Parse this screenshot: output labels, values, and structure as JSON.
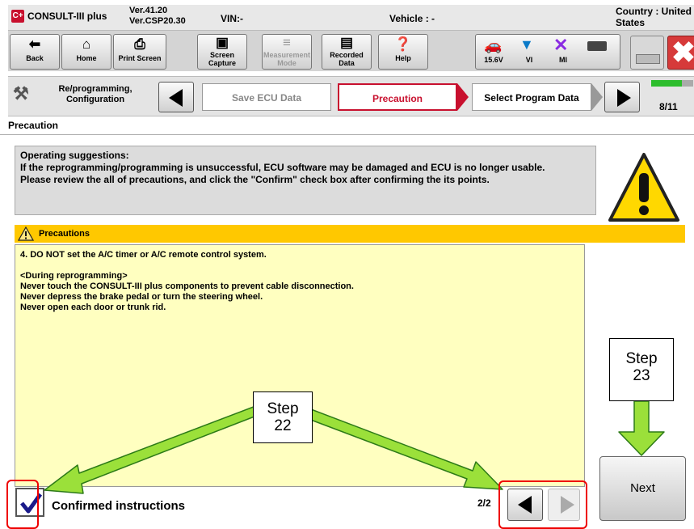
{
  "titlebar": {
    "app_logo": "C+",
    "app_name": "CONSULT-III plus",
    "version_line1": "Ver.41.20",
    "version_line2": "Ver.CSP20.30",
    "vin_label": "VIN:-",
    "vehicle_label": "Vehicle : -",
    "country_line1": "Country : United",
    "country_line2": "States"
  },
  "toolbar": {
    "buttons": [
      {
        "label": "Back",
        "icon": "back-arrow-icon"
      },
      {
        "label": "Home",
        "icon": "home-icon"
      },
      {
        "label": "Print Screen",
        "icon": "printer-icon"
      },
      {
        "label_line1": "Screen",
        "label_line2": "Capture",
        "icon": "camera-icon"
      },
      {
        "label_line1": "Measurement",
        "label_line2": "Mode",
        "icon": "measurement-icon"
      },
      {
        "label_line1": "Recorded",
        "label_line2": "Data",
        "icon": "recorded-data-icon"
      },
      {
        "label": "Help",
        "icon": "help-icon"
      }
    ],
    "status": {
      "voltage": "15.6V",
      "vi": "VI",
      "mi": "MI"
    }
  },
  "stepbar": {
    "section_line1": "Re/programming,",
    "section_line2": "Configuration",
    "prev_step": "Save ECU Data",
    "current_step": "Precaution",
    "next_step": "Select Program Data",
    "progress_label": "8/11",
    "progress_fraction": 0.727
  },
  "page_title": "Precaution",
  "suggestions": {
    "heading": "Operating  suggestions:",
    "line1": "If the reprogramming/programming is unsuccessful, ECU software may be damaged and ECU is no longer usable.",
    "line2": "Please review the all of precautions, and click the \"Confirm\" check box after confirming the its points."
  },
  "precautions": {
    "header": "Precautions",
    "item": "4. DO NOT set the A/C timer or A/C remote control system.",
    "subheading": "<During  reprogramming>",
    "lines": [
      "Never touch the CONSULT-III plus components to prevent cable disconnection.",
      "Never depress the brake pedal or turn the steering wheel.",
      "Never open each door or trunk rid."
    ]
  },
  "footer": {
    "confirm_label": "Confirmed instructions",
    "checkbox_checked": true,
    "page_count": "2/2",
    "next_label": "Next"
  },
  "annotations": {
    "step22_line1": "Step",
    "step22_line2": "22",
    "step23_line1": "Step",
    "step23_line2": "23"
  },
  "colors": {
    "accent_red": "#c8102e",
    "precaution_header": "#ffc800",
    "precaution_body": "#ffffc0",
    "annotation_arrow": "#9be03a",
    "annotation_frame": "#ee0000"
  }
}
